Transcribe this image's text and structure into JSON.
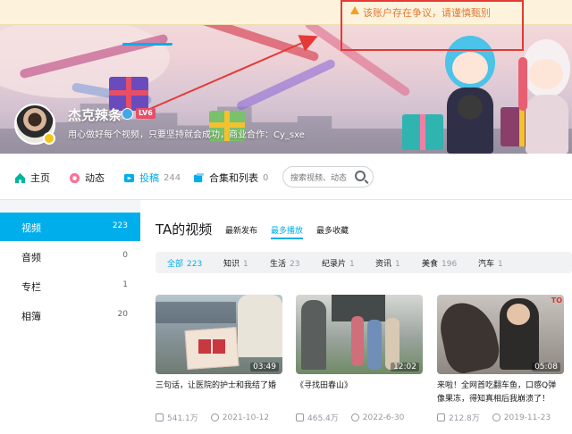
{
  "notice": {
    "text": "该账户存在争议，请谨慎甄别",
    "icon": "warning-icon"
  },
  "profile": {
    "username": "杰克辣条",
    "level": "LV6",
    "sign": "用心做好每个视频，只要坚持就会成功，商业合作：Cy_sxe"
  },
  "nav": {
    "tabs": [
      {
        "label": "主页",
        "count": ""
      },
      {
        "label": "动态",
        "count": ""
      },
      {
        "label": "投稿",
        "count": "244"
      },
      {
        "label": "合集和列表",
        "count": "0"
      }
    ],
    "search_placeholder": "搜索视频、动态"
  },
  "sidebar": {
    "items": [
      {
        "label": "视频",
        "count": "223"
      },
      {
        "label": "音频",
        "count": "0"
      },
      {
        "label": "专栏",
        "count": "1"
      },
      {
        "label": "相簿",
        "count": "20"
      }
    ]
  },
  "main": {
    "title": "TA的视频",
    "sorts": [
      "最新发布",
      "最多播放",
      "最多收藏"
    ],
    "filters": [
      {
        "label": "全部",
        "count": "223"
      },
      {
        "label": "知识",
        "count": "1"
      },
      {
        "label": "生活",
        "count": "23"
      },
      {
        "label": "纪录片",
        "count": "1"
      },
      {
        "label": "资讯",
        "count": "1"
      },
      {
        "label": "美食",
        "count": "196"
      },
      {
        "label": "汽车",
        "count": "1"
      }
    ],
    "videos": [
      {
        "title": "三句话，让医院的护士和我结了婚",
        "duration": "03:49",
        "plays": "541.1万",
        "date": "2021-10-12"
      },
      {
        "title": "《寻找田春山》",
        "duration": "12:02",
        "plays": "465.4万",
        "date": "2022-6-30"
      },
      {
        "title": "来啦！全网首吃翻车鱼，口感Q弹像果冻，得知真相后我崩溃了！",
        "duration": "05:08",
        "plays": "212.8万",
        "date": "2019-11-23"
      }
    ]
  },
  "colors": {
    "accent": "#00aeec",
    "warning": "#e07a3a",
    "annotation": "#e53935"
  }
}
